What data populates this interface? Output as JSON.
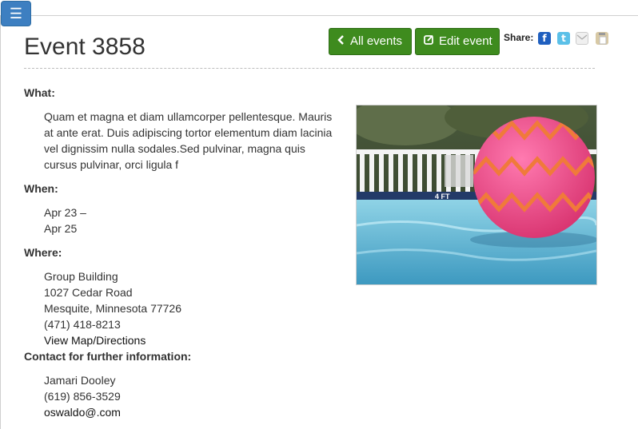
{
  "nav": {
    "menu_glyph": "☰"
  },
  "event": {
    "title": "Event 3858"
  },
  "toolbar": {
    "all_events_icon": "chevron-left-icon",
    "all_events_label": "All events",
    "edit_icon": "edit-icon",
    "edit_label": "Edit event",
    "share_label": "Share:",
    "share_icons": [
      "facebook-icon",
      "twitter-icon",
      "email-icon",
      "clipboard-icon"
    ],
    "facebook_glyph": "f",
    "twitter_glyph": "t"
  },
  "what": {
    "label": "What:",
    "description": "Quam et magna et diam ullamcorper pellentesque. Mauris at ante erat. Duis adipiscing tortor elementum diam lacinia vel dignissim nulla sodales.Sed pulvinar, magna quis cursus pulvinar, orci ligula f"
  },
  "when": {
    "label": "When:",
    "start": "Apr 23 –",
    "end": "Apr 25"
  },
  "where": {
    "label": "Where:",
    "venue": "Group Building",
    "street": "1027 Cedar Road",
    "city": "Mesquite, Minnesota 77726",
    "phone": "(471) 418-8213",
    "map_link": "View Map/Directions"
  },
  "contact": {
    "label": "Contact for further information:",
    "name": "Jamari Dooley",
    "phone": "(619) 856-3529",
    "email": "oswaldo@.com"
  },
  "photo": {
    "sign_text": "4 FT"
  },
  "colors": {
    "accent_green": "#3e8b1e",
    "menu_blue": "#3d7fc1"
  }
}
